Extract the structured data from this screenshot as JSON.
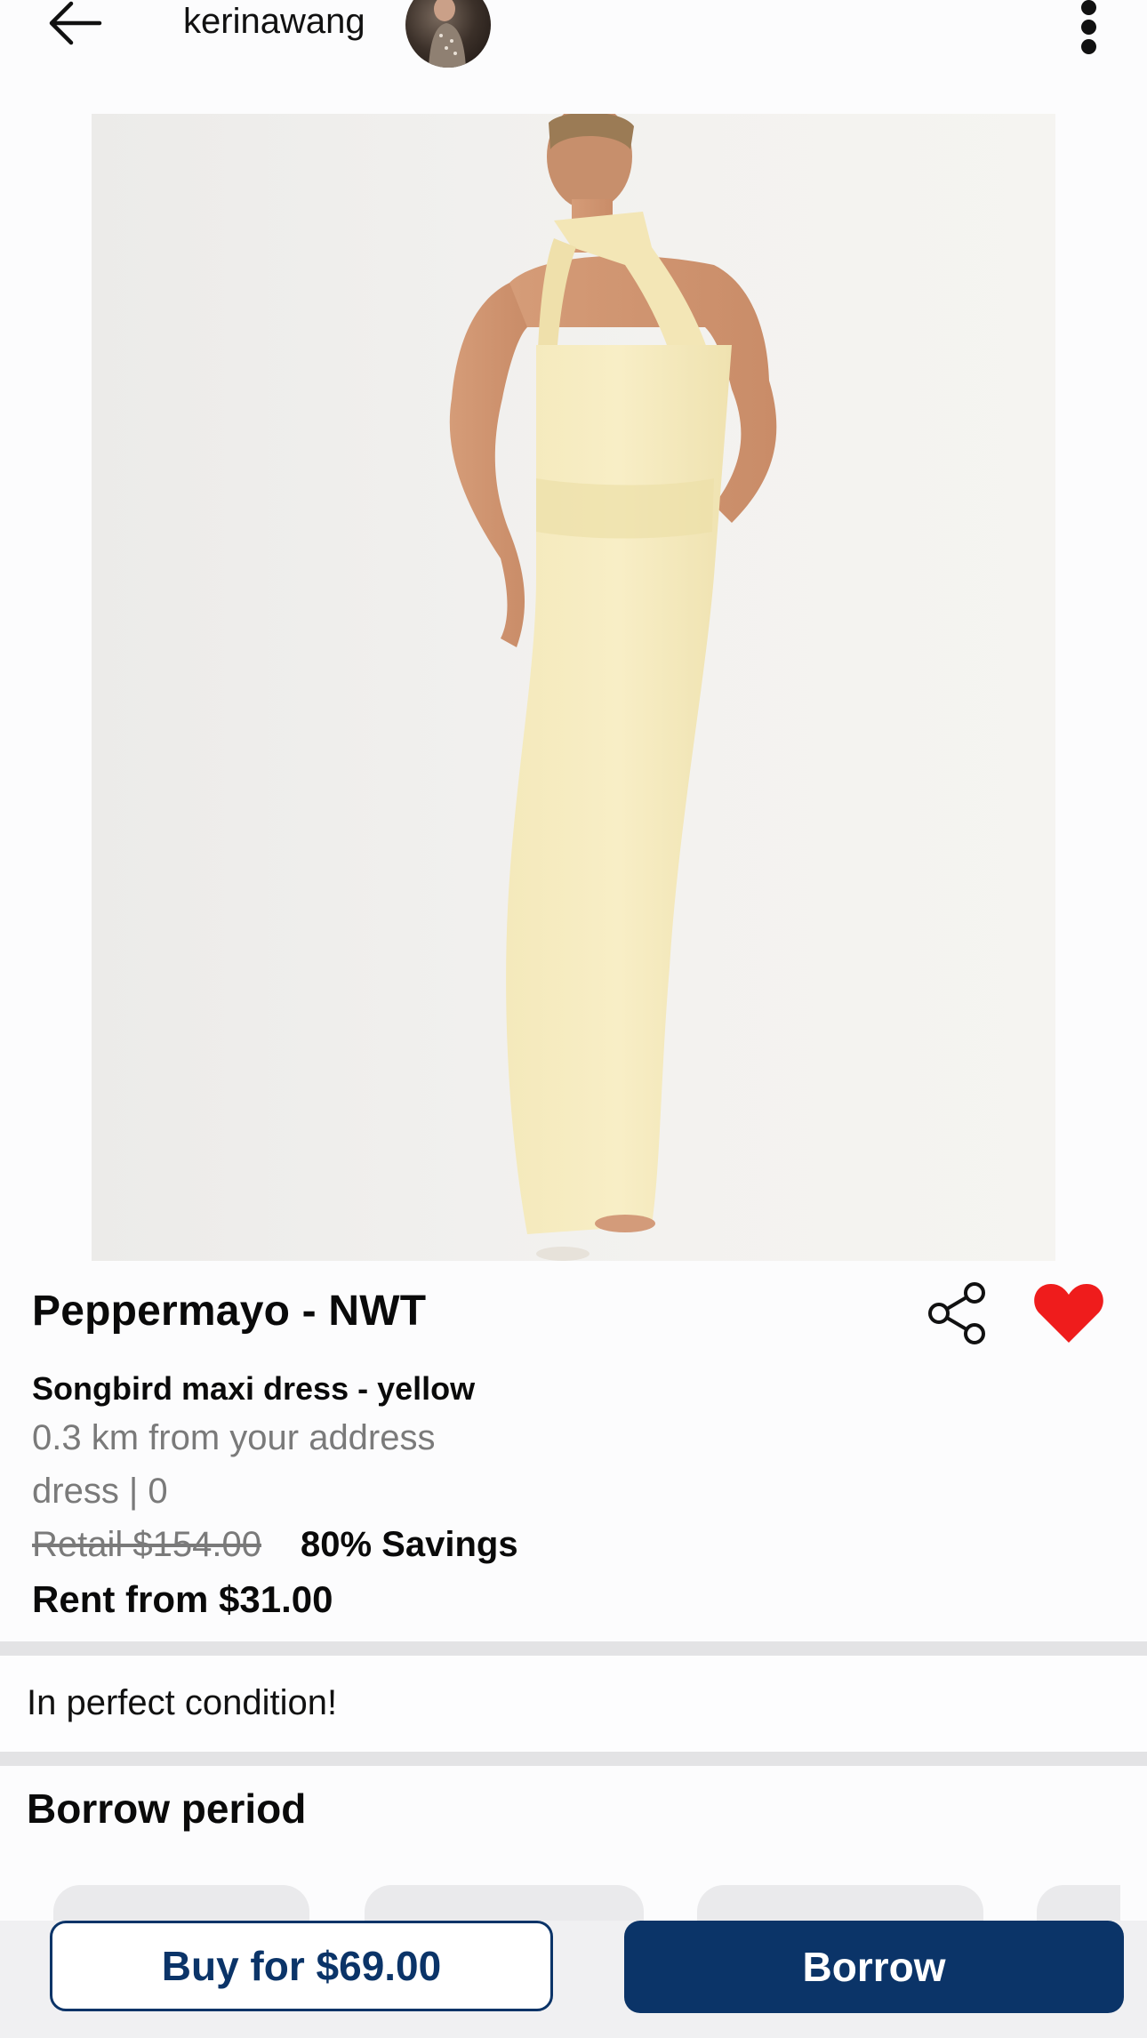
{
  "header": {
    "back_icon": "arrow-left-icon",
    "username": "kerinawang",
    "more_icon": "more-vertical-icon"
  },
  "product": {
    "image_icon": "product-photo",
    "brand_title": "Peppermayo - NWT",
    "subtitle": "Songbird maxi dress - yellow",
    "distance": "0.3 km from your address",
    "category": "dress | 0",
    "retail_price": "Retail $154.00",
    "savings": "80% Savings",
    "rent_price": "Rent from $31.00",
    "share_icon": "share-icon",
    "favorite_icon": "heart-icon",
    "favorite_color": "#ef1c1c"
  },
  "description": {
    "note": "In perfect condition!"
  },
  "borrow_period": {
    "title": "Borrow period"
  },
  "actions": {
    "buy_label": "Buy for $69.00",
    "borrow_label": "Borrow",
    "accent_color": "#0b3468"
  }
}
